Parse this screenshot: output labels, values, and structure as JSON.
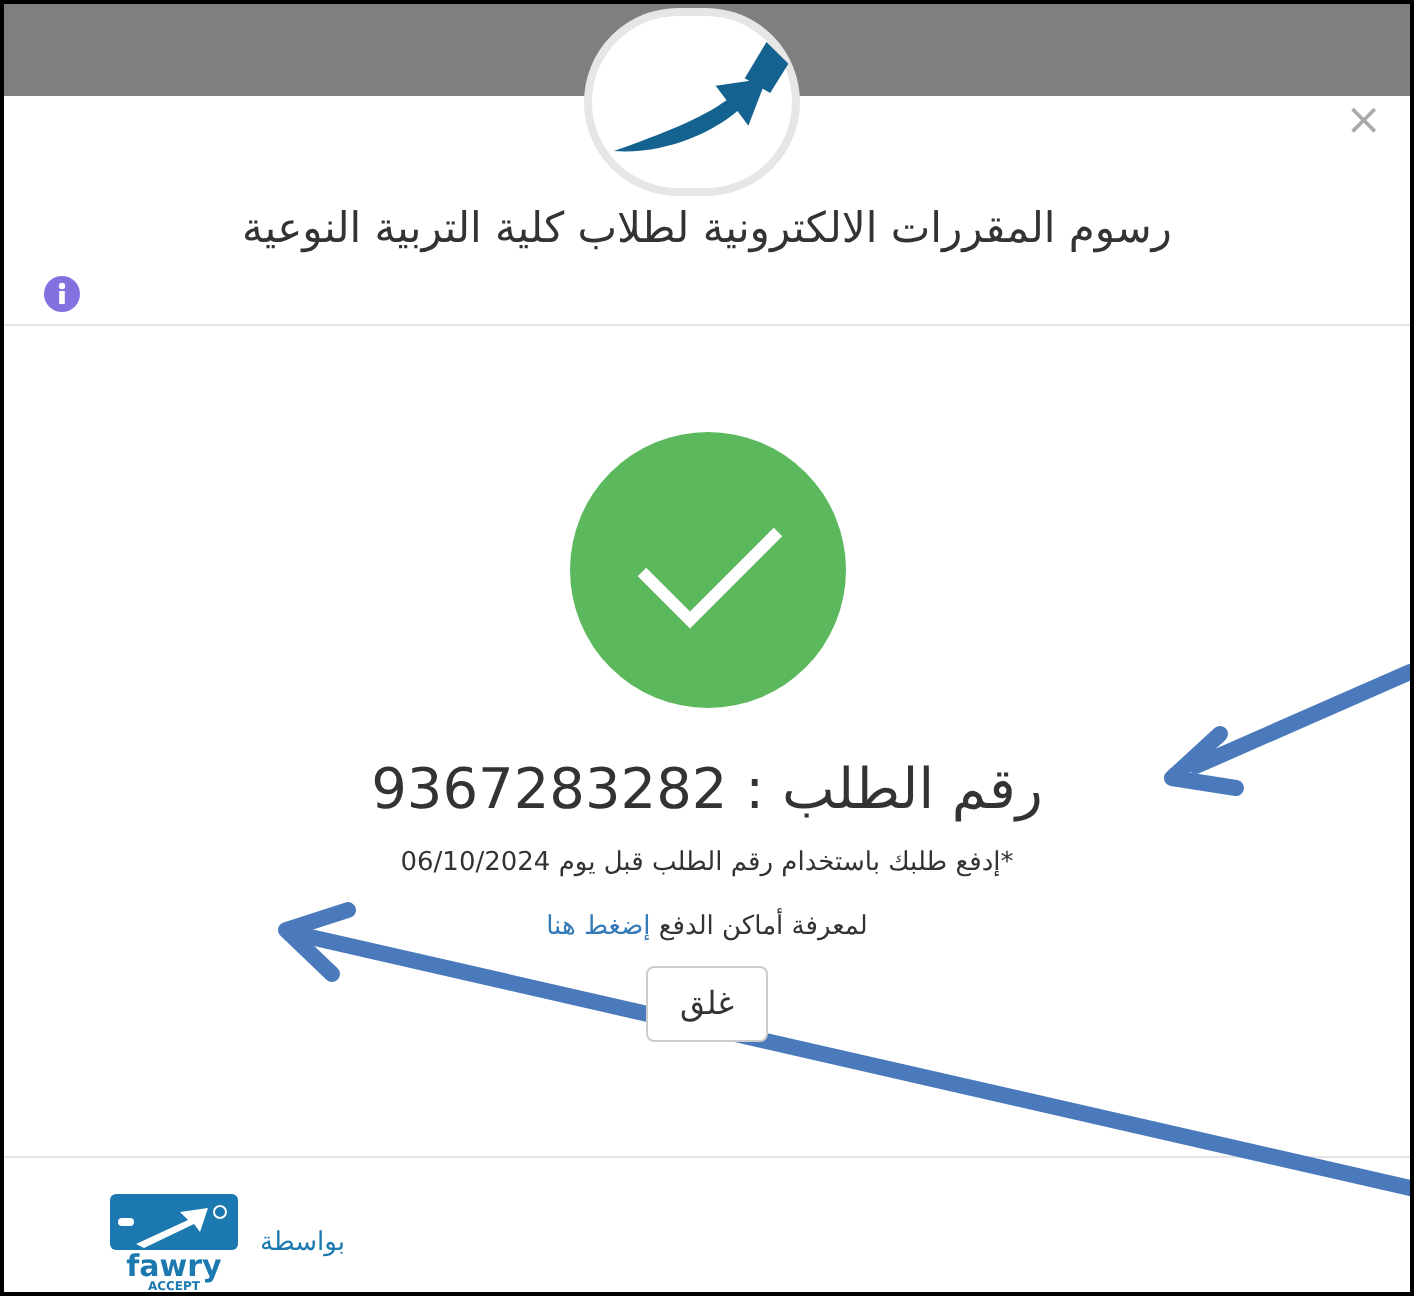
{
  "dialog": {
    "title": "رسوم المقررات الالكترونية لطلاب كلية التربية النوعية",
    "close": "×"
  },
  "result": {
    "order": "رقم الطلب : 9367283282",
    "note": "*إدفع طلبك باستخدام رقم الطلب قبل يوم 06/10/2024",
    "places_text": "لمعرفة أماكن الدفع",
    "places_link": "إضغط هنا",
    "button": "غلق"
  },
  "footer": {
    "via": "بواسطة",
    "logo_name": "fawry",
    "logo_sub": "ACCEPT"
  }
}
